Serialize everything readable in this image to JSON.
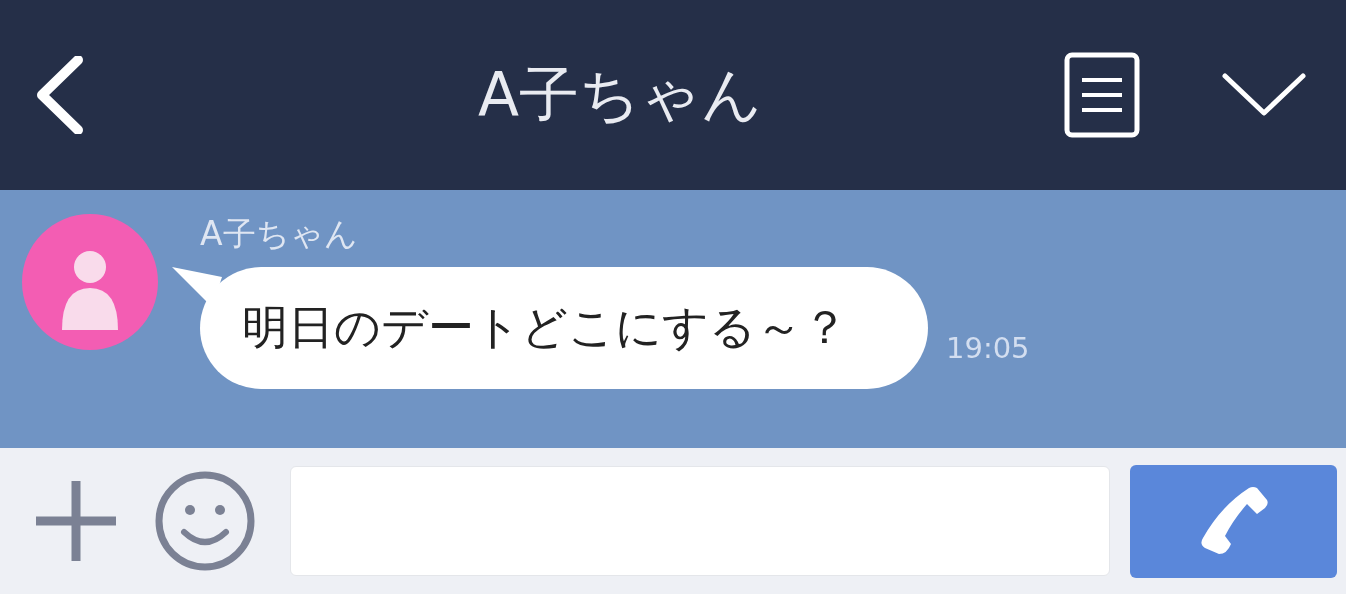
{
  "header": {
    "title": "A子ちゃん"
  },
  "messages": [
    {
      "sender": "A子ちゃん",
      "text": "明日のデートどこにする～？",
      "time": "19:05"
    }
  ]
}
